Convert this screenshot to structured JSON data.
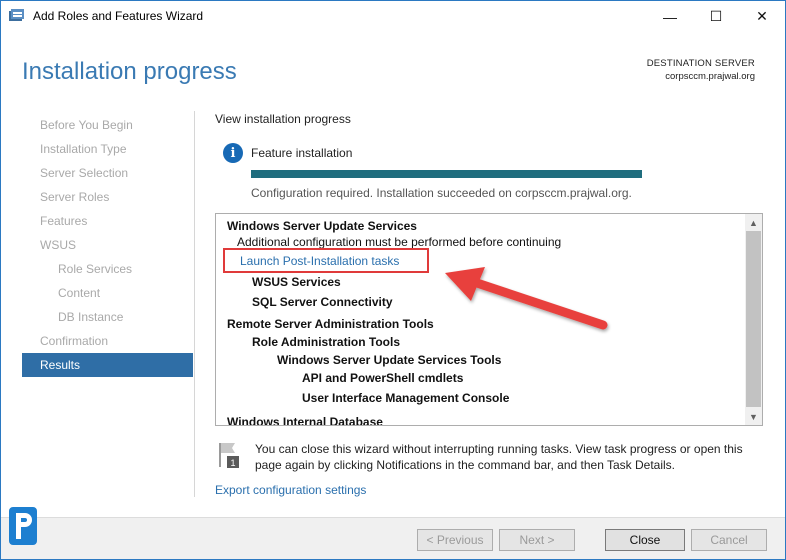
{
  "window": {
    "title": "Add Roles and Features Wizard",
    "minimize_glyph": "—",
    "maximize_glyph": "☐",
    "close_glyph": "✕"
  },
  "header": {
    "title": "Installation progress",
    "destination_label": "DESTINATION SERVER",
    "destination_name": "corpsccm.prajwal.org"
  },
  "nav": {
    "items": [
      {
        "label": "Before You Begin"
      },
      {
        "label": "Installation Type"
      },
      {
        "label": "Server Selection"
      },
      {
        "label": "Server Roles"
      },
      {
        "label": "Features"
      },
      {
        "label": "WSUS"
      },
      {
        "label": "Role Services"
      },
      {
        "label": "Content"
      },
      {
        "label": "DB Instance"
      },
      {
        "label": "Confirmation"
      },
      {
        "label": "Results"
      }
    ]
  },
  "content": {
    "title": "View installation progress",
    "info_glyph": "i",
    "feature_label": "Feature installation",
    "progress_fraction": 1.0,
    "status": "Configuration required. Installation succeeded on corpsccm.prajwal.org."
  },
  "results": {
    "lines": [
      {
        "text": "Windows Server Update Services"
      },
      {
        "text": "Additional configuration must be performed before continuing"
      },
      {
        "text": "Launch Post-Installation tasks"
      },
      {
        "text": "WSUS Services"
      },
      {
        "text": "SQL Server Connectivity"
      },
      {
        "text": "Remote Server Administration Tools"
      },
      {
        "text": "Role Administration Tools"
      },
      {
        "text": "Windows Server Update Services Tools"
      },
      {
        "text": "API and PowerShell cmdlets"
      },
      {
        "text": "User Interface Management Console"
      },
      {
        "text": "Windows Internal Database"
      }
    ]
  },
  "notice": {
    "badge": "1",
    "text": "You can close this wizard without interrupting running tasks. View task progress or open this page again by clicking Notifications in the command bar, and then Task Details."
  },
  "export_link": "Export configuration settings",
  "footer": {
    "previous": "< Previous",
    "next": "Next >",
    "close": "Close",
    "cancel": "Cancel"
  },
  "colors": {
    "accent": "#3a7ab3",
    "nav_active": "#2f6ea6",
    "progress": "#1f6d7e",
    "highlight": "#e03a3a",
    "link": "#2a6fad"
  }
}
